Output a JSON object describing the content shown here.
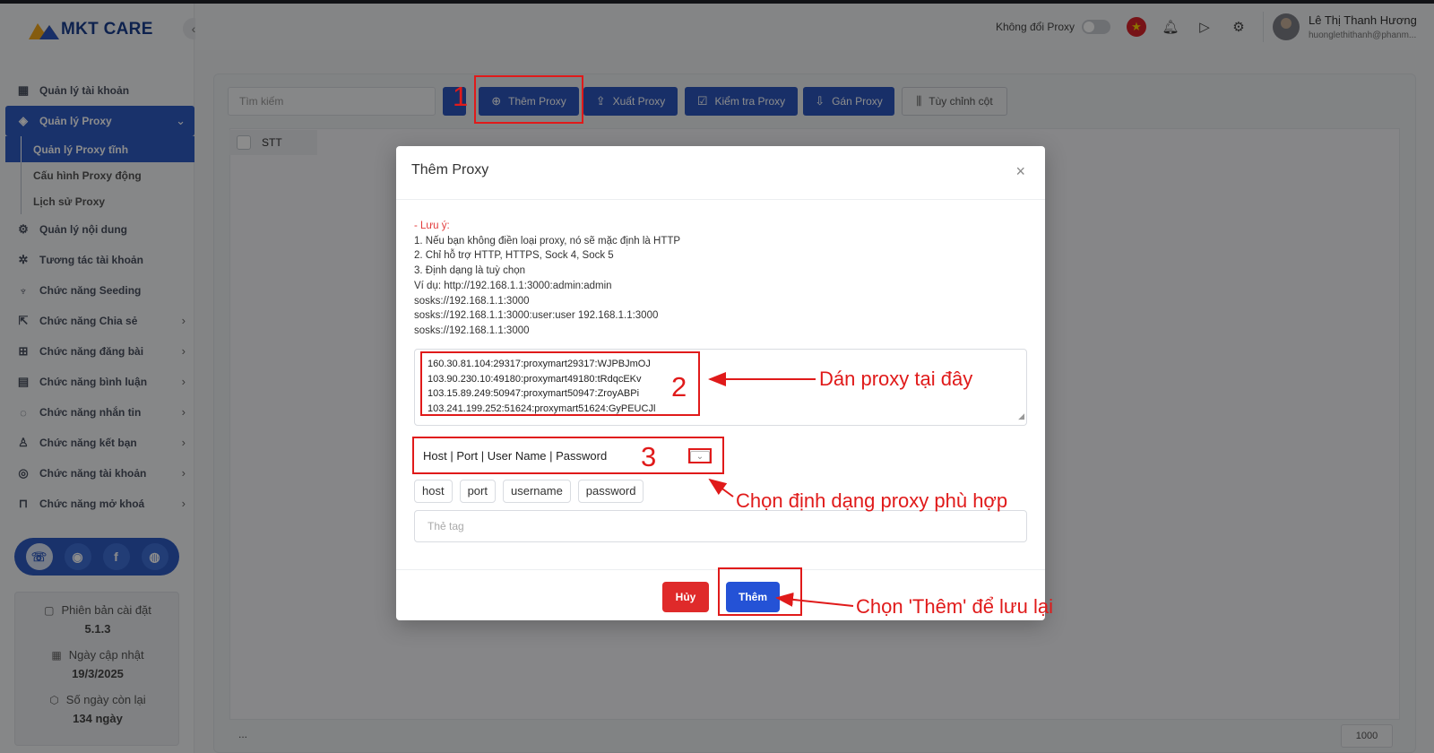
{
  "app": {
    "logo": "MKT CARE",
    "collapse_icon": "‹"
  },
  "sidebar": {
    "items": [
      {
        "label": "Quản lý tài khoản",
        "icon": "grid-icon"
      },
      {
        "label": "Quản lý Proxy",
        "icon": "layers-icon",
        "active": true
      },
      {
        "label": "Quản lý Proxy tĩnh",
        "sub": true,
        "active": true
      },
      {
        "label": "Cấu hình Proxy động",
        "sub": true
      },
      {
        "label": "Lịch sử Proxy",
        "sub": true
      },
      {
        "label": "Quản lý nội dung",
        "icon": "content-icon"
      },
      {
        "label": "Tương tác tài khoản",
        "icon": "interact-icon"
      },
      {
        "label": "Chức năng Seeding",
        "icon": "seeding-icon"
      },
      {
        "label": "Chức năng Chia sẻ",
        "icon": "share-icon"
      },
      {
        "label": "Chức năng đăng bài",
        "icon": "post-icon"
      },
      {
        "label": "Chức năng bình luận",
        "icon": "comment-icon"
      },
      {
        "label": "Chức năng nhắn tin",
        "icon": "message-icon"
      },
      {
        "label": "Chức năng kết bạn",
        "icon": "add-friend-icon"
      },
      {
        "label": "Chức năng tài khoản",
        "icon": "account-icon"
      },
      {
        "label": "Chức năng mở khoá",
        "icon": "lock-icon"
      }
    ],
    "version_label": "Phiên bản cài đặt",
    "version_value": "5.1.3",
    "update_label": "Ngày cập nhật",
    "update_value": "19/3/2025",
    "days_label": "Số ngày còn lại",
    "days_value": "134 ngày"
  },
  "header": {
    "proxy_toggle_label": "Không đổi Proxy",
    "user_name": "Lê Thị Thanh Hương",
    "user_email": "huonglethithanh@phanm..."
  },
  "toolbar": {
    "search_placeholder": "Tìm kiếm",
    "add_proxy": "Thêm Proxy",
    "export_proxy": "Xuất Proxy",
    "check_proxy": "Kiểm tra Proxy",
    "assign_proxy": "Gán Proxy",
    "customize_columns": "Tùy chỉnh cột"
  },
  "table": {
    "header_stt": "STT",
    "footer_dots": "...",
    "page_size": "1000"
  },
  "modal": {
    "title": "Thêm Proxy",
    "close": "×",
    "note_title": "- Lưu ý:",
    "note_lines": [
      "1. Nếu bạn không điền loại proxy, nó sẽ mặc định là HTTP",
      "2. Chỉ hỗ trợ HTTP, HTTPS, Sock 4, Sock 5",
      "3. Định dạng là tuỳ chọn",
      "Ví dụ: http://192.168.1.1:3000:admin:admin",
      "sosks://192.168.1.1:3000",
      "sosks://192.168.1.1:3000:user:user 192.168.1.1:3000",
      "sosks://192.168.1.1:3000"
    ],
    "proxies": [
      "160.30.81.104:29317:proxymart29317:WJPBJmOJ",
      "103.90.230.10:49180:proxymart49180:tRdqcEKv",
      "103.15.89.249:50947:proxymart50947:ZroyABPi",
      "103.241.199.252:51624:proxymart51624:GyPEUCJl"
    ],
    "format_select": "Host | Port | User Name | Password",
    "tags": [
      "host",
      "port",
      "username",
      "password"
    ],
    "tag_placeholder": "Thẻ tag",
    "cancel": "Hủy",
    "add": "Thêm"
  },
  "annotations": {
    "n1": "1",
    "n2": "2",
    "n3": "3",
    "paste_hint": "Dán proxy tại đây",
    "format_hint": "Chọn định dạng proxy phù hợp",
    "save_hint": "Chọn 'Thêm' để lưu lại"
  },
  "colors": {
    "primary": "#2c56bd",
    "danger": "#df2a2a",
    "annotation": "#e01a1a"
  }
}
